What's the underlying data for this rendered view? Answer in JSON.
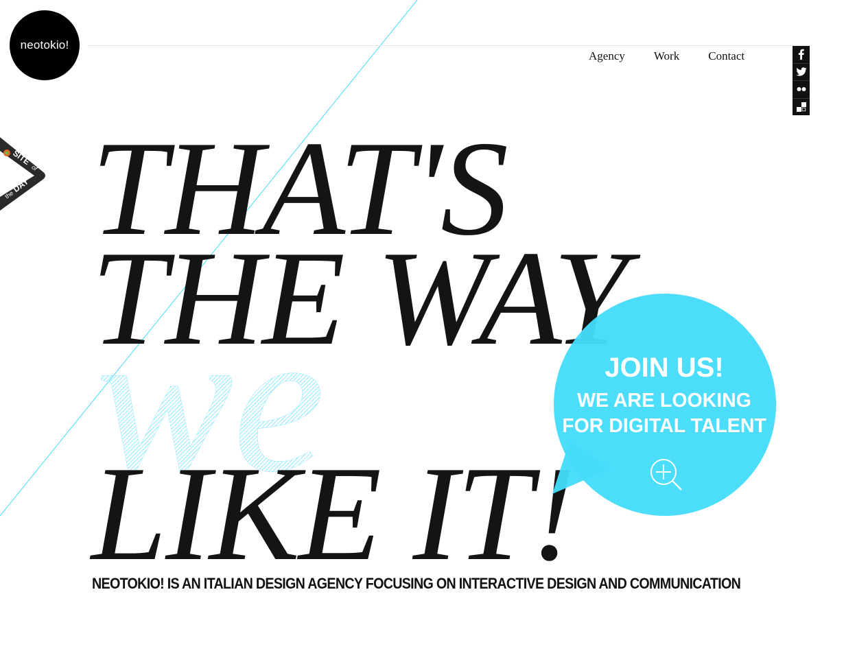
{
  "logo": {
    "text": "neotokio!"
  },
  "nav": {
    "items": [
      {
        "label": "Agency"
      },
      {
        "label": "Work"
      },
      {
        "label": "Contact"
      }
    ]
  },
  "social": {
    "items": [
      {
        "icon": "facebook-icon"
      },
      {
        "icon": "twitter-icon"
      },
      {
        "icon": "flickr-icon"
      },
      {
        "icon": "delicious-icon"
      }
    ]
  },
  "badge": {
    "line1": "SITE",
    "line2": "of",
    "line3": "the",
    "line4": "DAY"
  },
  "headline": {
    "line1": "THAT'S",
    "line2": "THE WAY",
    "accent": "we",
    "line3": "LIKE IT!"
  },
  "join": {
    "title": "JOIN US!",
    "line1": "WE ARE LOOKING",
    "line2": "FOR DIGITAL TALENT",
    "icon": "zoom-in-icon"
  },
  "tagline": "NEOTOKIO! IS AN ITALIAN DESIGN AGENCY FOCUSING ON INTERACTIVE DESIGN AND COMMUNICATION",
  "colors": {
    "accent": "#45dcfb",
    "text": "#141414",
    "background": "#ffffff"
  }
}
